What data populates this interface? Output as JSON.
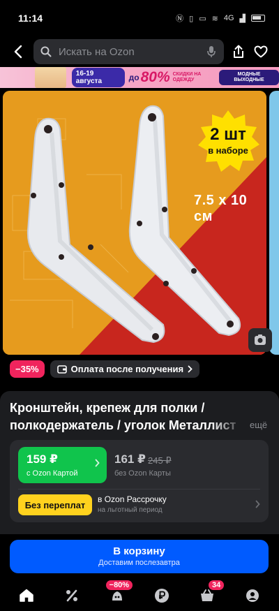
{
  "status": {
    "time": "11:14",
    "icons": [
      "nfc-icon",
      "vibrate-icon",
      "volte-icon",
      "wifi-icon",
      "signal-icon",
      "battery-icon"
    ],
    "net": "4G"
  },
  "header": {
    "search_placeholder": "Искать на Ozon"
  },
  "promo": {
    "dates": "16-19 августа",
    "upto": "до",
    "percent": "80%",
    "sale_text": "СКИДКИ НА ОДЕЖДУ",
    "weekend": "МОДНЫЕ ВЫХОДНЫЕ"
  },
  "product_image": {
    "badge_count": "2 шт",
    "badge_text": "в наборе",
    "dimensions": "7.5 x 10 см",
    "bg_colors": [
      "#e69b1e",
      "#c8261e"
    ]
  },
  "chips": {
    "discount": "−35%",
    "pay_after": "Оплата после получения"
  },
  "product": {
    "title_line1": "Кронштейн, крепеж для полки /",
    "title_line2": "полкодержатель / уголок Металлист",
    "more": "ещё"
  },
  "price": {
    "card_value": "159 ₽",
    "card_label": "с Ozon Картой",
    "regular_value": "161 ₽",
    "old_value": "245 ₽",
    "regular_label": "без Ozon Карты",
    "no_overpay": "Без переплат",
    "installment": "в Ozon Рассрочку",
    "installment_note": "на льготный период"
  },
  "cart": {
    "label": "В корзину",
    "sublabel": "Доставим послезавтра"
  },
  "nav": {
    "home": "",
    "promo": "",
    "fresh_badge": "−80%",
    "finance": "",
    "cart_badge": "34",
    "profile": ""
  },
  "colors": {
    "accent": "#005bff",
    "green": "#10c44c",
    "pink": "#f0245d",
    "yellow": "#ffd21e"
  }
}
